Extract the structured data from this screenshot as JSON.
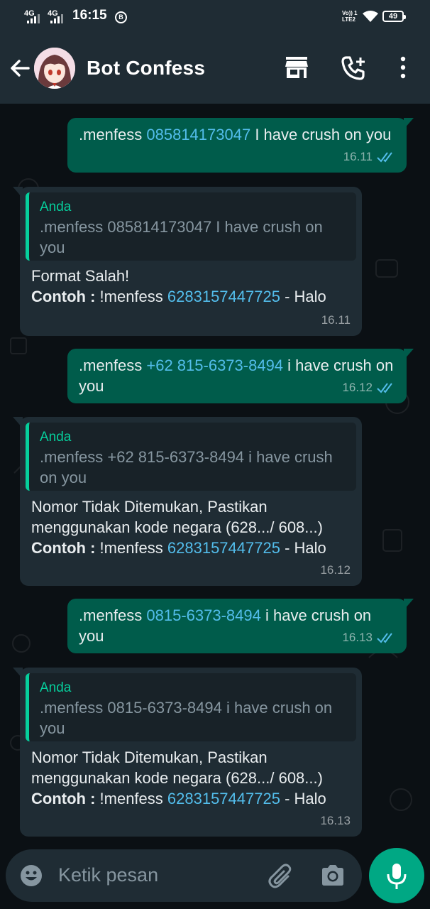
{
  "status_bar": {
    "net1": "4G",
    "net2": "4G",
    "time": "16:15",
    "notif_letter": "B",
    "volte_line1": "Vo)) 1",
    "volte_line2": "LTE2",
    "battery": "49"
  },
  "header": {
    "title": "Bot Confess"
  },
  "messages": [
    {
      "type": "outgoing",
      "prefix": ".menfess ",
      "number": "085814173047",
      "suffix": " I have crush on you",
      "time": "16.11"
    },
    {
      "type": "incoming",
      "quote_author": "Anda",
      "quote_text": ".menfess 085814173047 I have crush on you",
      "line1": "Format Salah!",
      "example_label": "Contoh :",
      "example_prefix": " !menfess ",
      "example_number": "6283157447725",
      "example_suffix": " - Halo",
      "time": "16.11"
    },
    {
      "type": "outgoing",
      "prefix": ".menfess ",
      "number": "+62 815-6373-8494",
      "suffix": " i have crush on you",
      "time": "16.12"
    },
    {
      "type": "incoming",
      "quote_author": "Anda",
      "quote_text": ".menfess +62 815-6373-8494 i have crush on you",
      "line1": "Nomor Tidak Ditemukan, Pastikan menggunakan kode negara (628.../ 608...)",
      "example_label": "Contoh :",
      "example_prefix": " !menfess ",
      "example_number": "6283157447725",
      "example_suffix": " - Halo",
      "time": "16.12"
    },
    {
      "type": "outgoing",
      "prefix": ".menfess ",
      "number": "0815-6373-8494",
      "suffix": " i have crush on you",
      "time": "16.13"
    },
    {
      "type": "incoming",
      "quote_author": "Anda",
      "quote_text": ".menfess 0815-6373-8494 i have crush on you",
      "line1": "Nomor Tidak Ditemukan, Pastikan menggunakan kode negara (628.../ 608...)",
      "example_label": "Contoh :",
      "example_prefix": " !menfess ",
      "example_number": "6283157447725",
      "example_suffix": " - Halo",
      "time": "16.13"
    }
  ],
  "input": {
    "placeholder": "Ketik pesan"
  },
  "icons": {
    "back": "arrow-left-icon",
    "store": "store-icon",
    "add_call": "add-call-icon",
    "menu": "more-vertical-icon",
    "emoji": "emoji-icon",
    "attach": "paperclip-icon",
    "camera": "camera-icon",
    "mic": "mic-icon",
    "read": "double-check-icon"
  },
  "colors": {
    "outgoing_bubble": "#005c4b",
    "incoming_bubble": "#1f2c34",
    "link": "#53bdeb",
    "accent": "#00a884",
    "read_tick": "#53bdeb"
  }
}
